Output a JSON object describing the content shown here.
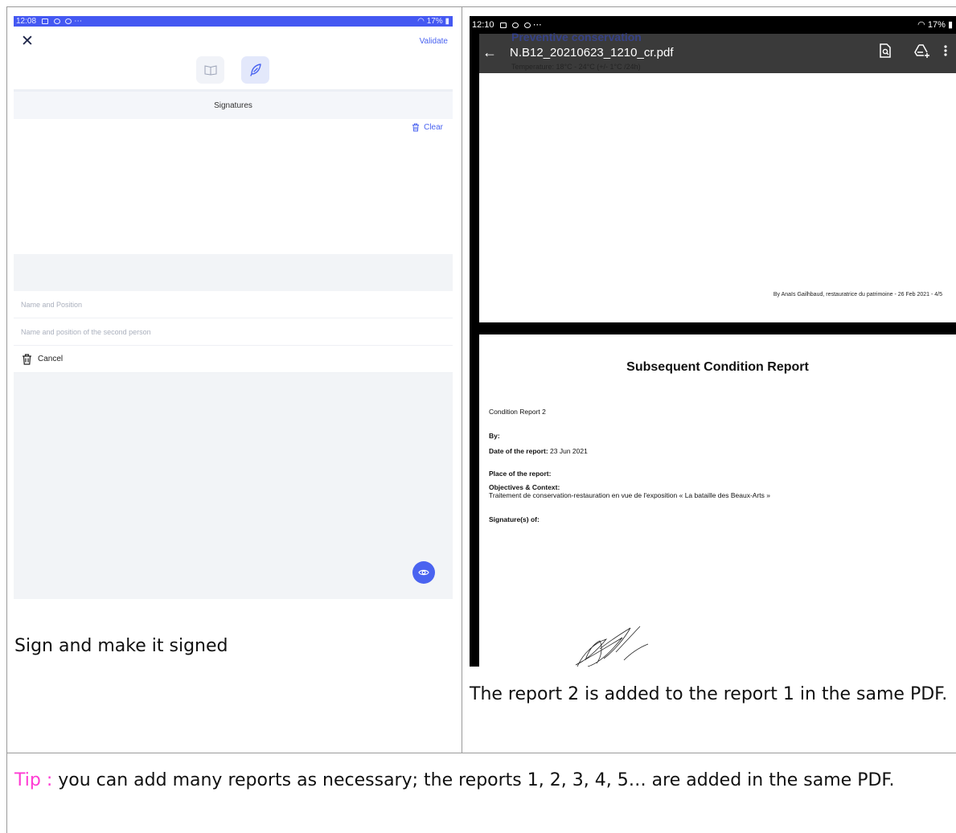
{
  "left_screenshot": {
    "status_bar": {
      "time": "12:08",
      "icons": "⋯",
      "battery": "17%"
    },
    "toolbar": {
      "validate_label": "Validate"
    },
    "section": {
      "title": "Signatures"
    },
    "signature_pad": {
      "clear_label": "Clear"
    },
    "fields": {
      "name_position_placeholder": "Name and Position",
      "second_person_placeholder": "Name and position of the second person"
    },
    "cancel_label": "Cancel",
    "colors": {
      "status_bar": "#4458f2",
      "accent": "#4a63f0"
    },
    "icons": [
      "close-icon",
      "book-icon",
      "feather-icon",
      "trash-icon",
      "eye-icon"
    ]
  },
  "left_caption": "Sign and make it signed",
  "right_screenshot": {
    "status_bar": {
      "time": "12:10",
      "icons": "⋯",
      "battery": "17%"
    },
    "file_name": "N.B12_20210623_1210_cr.pdf",
    "bleed_through": {
      "title": "Preventive conservation",
      "line": "Temperature: 18°C - 24°C (+/- 1°C /24h)"
    },
    "page1_footer": "By Anaïs Gailhbaud, restauratrice du patrimoine - 26 Feb 2021 - 4/5",
    "page2": {
      "title": "Subsequent Condition Report",
      "report_name": "Condition Report 2",
      "by_label": "By:",
      "date_label": "Date of the report:",
      "date_value": "23 Jun 2021",
      "place_label": "Place of the report:",
      "objectives_label": "Objectives & Context:",
      "objectives_value": "Traitement de conservation-restauration en vue de l'exposition « La bataille des Beaux-Arts »",
      "signatures_label": "Signature(s) of:"
    },
    "icons": [
      "back-arrow-icon",
      "search-doc-icon",
      "add-to-drive-icon",
      "more-vert-icon"
    ]
  },
  "right_caption": "The report 2 is added to the report 1 in the same PDF.",
  "tip": {
    "label": "Tip :",
    "text": " you can  add many reports as necessary; the reports 1, 2, 3, 4, 5… are added in the same PDF."
  }
}
